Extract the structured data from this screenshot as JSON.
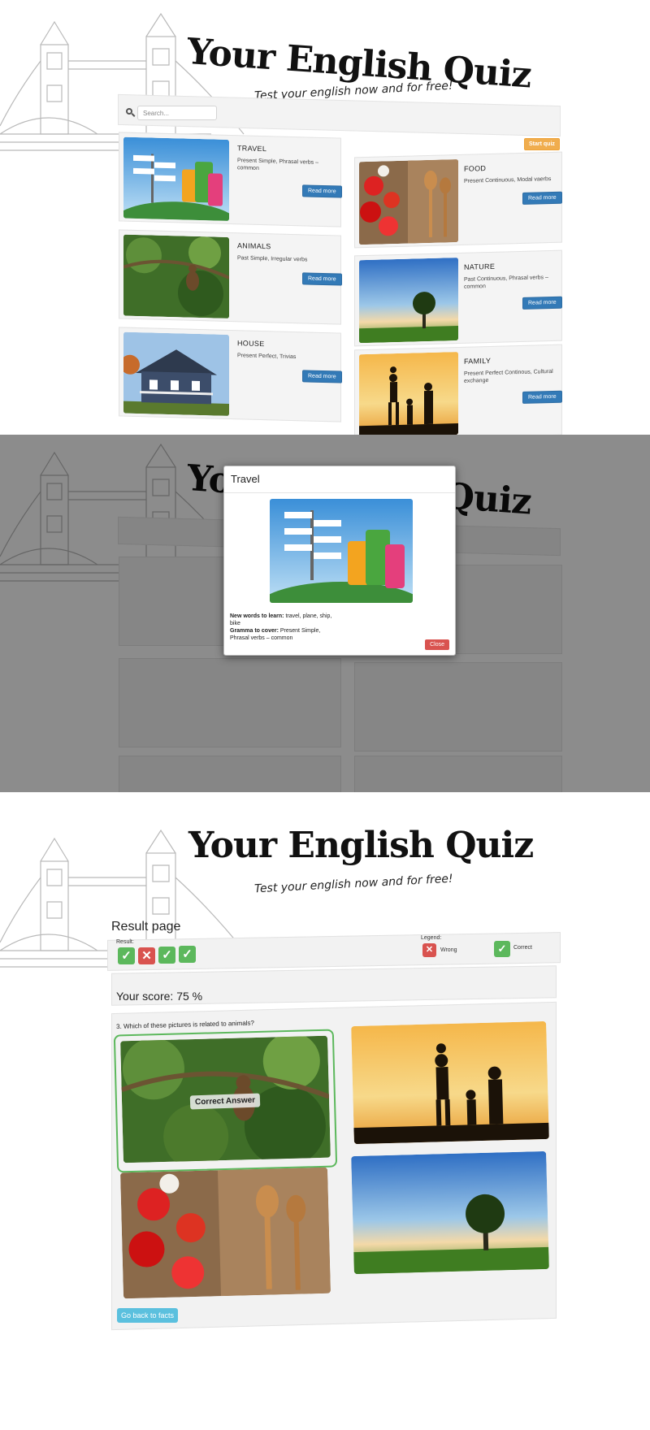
{
  "logo": {
    "title": "Your English Quiz",
    "subtitle": "Test your english now and for free!"
  },
  "toolbar": {
    "search_placeholder": "Search...",
    "start_label": "Start quiz"
  },
  "cards": [
    {
      "title": "TRAVEL",
      "desc": "Present Simple, Phrasal verbs – common",
      "button": "Read more"
    },
    {
      "title": "FOOD",
      "desc": "Present Continuous, Modal vaerbs",
      "button": "Read more"
    },
    {
      "title": "ANIMALS",
      "desc": "Past Simple, Irregular verbs",
      "button": "Read more"
    },
    {
      "title": "NATURE",
      "desc": "Past Continuous, Phrasal verbs – common",
      "button": "Read more"
    },
    {
      "title": "HOUSE",
      "desc": "Present Perfect, Trivias",
      "button": "Read more"
    },
    {
      "title": "FAMILY",
      "desc": "Present Perfect Continous, Cultural exchange",
      "button": "Read more"
    }
  ],
  "modal": {
    "title": "Travel",
    "words_label": "New words to learn:",
    "words": "travel, plane, ship, bike",
    "grammar_label": "Gramma to cover:",
    "grammar": "Present Simple, Phrasal verbs – common",
    "close_label": "Close"
  },
  "result": {
    "page_title": "Result page",
    "result_label": "Result:",
    "legend_label": "Legend:",
    "legend_wrong": "Wrong",
    "legend_correct": "Correct",
    "answers": [
      "correct",
      "wrong",
      "correct",
      "correct"
    ],
    "score_text": "Your score: 75 %",
    "question": "3. Which of these pictures is related to animals?",
    "correct_badge": "Correct Answer",
    "back_label": "Go back to facts"
  },
  "colors": {
    "primary": "#337ab7",
    "warning": "#f0ad4e",
    "success": "#5cb85c",
    "danger": "#d9534f",
    "info": "#5bc0de"
  },
  "icons": [
    "search-icon",
    "check-icon",
    "cross-icon",
    "bridge-illustration"
  ]
}
